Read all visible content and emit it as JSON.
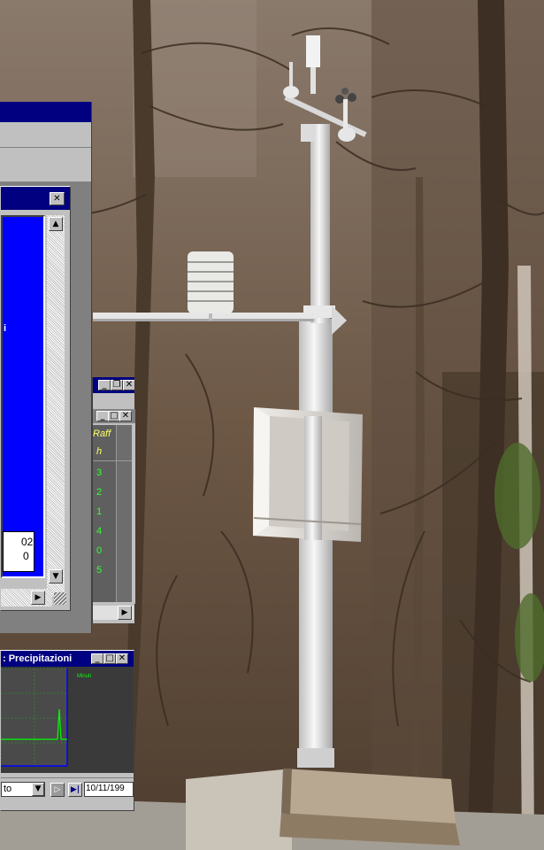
{
  "screens": {
    "precip_window_title": ": Precipitazioni",
    "chart_legend": "Minuti",
    "toolbar_select_value": "to",
    "toolbar_date": "10/11/199",
    "grid_header": "Raff",
    "grid_unit": "h",
    "grid_values": [
      "3",
      "2",
      "1",
      "4",
      "0",
      "5"
    ],
    "dialog_text_line1": "02",
    "dialog_text_line2": "0",
    "dialog_side_glyph": "i"
  },
  "icons": {
    "close": "close-icon",
    "minimize": "minimize-icon",
    "maximize": "maximize-icon",
    "restore": "restore-icon",
    "scroll_up": "arrow-up-icon",
    "scroll_down": "arrow-down-icon",
    "scroll_right": "arrow-right-icon",
    "dropdown": "chevron-down-icon",
    "play": "play-icon",
    "step": "step-icon"
  },
  "colors": {
    "win_face": "#c0c0c0",
    "win_title": "#000080",
    "dialog_blue": "#0000ff",
    "chart_bg": "#3a3a3a",
    "chart_line": "#00ff00",
    "chart_axis": "#0000ff"
  }
}
